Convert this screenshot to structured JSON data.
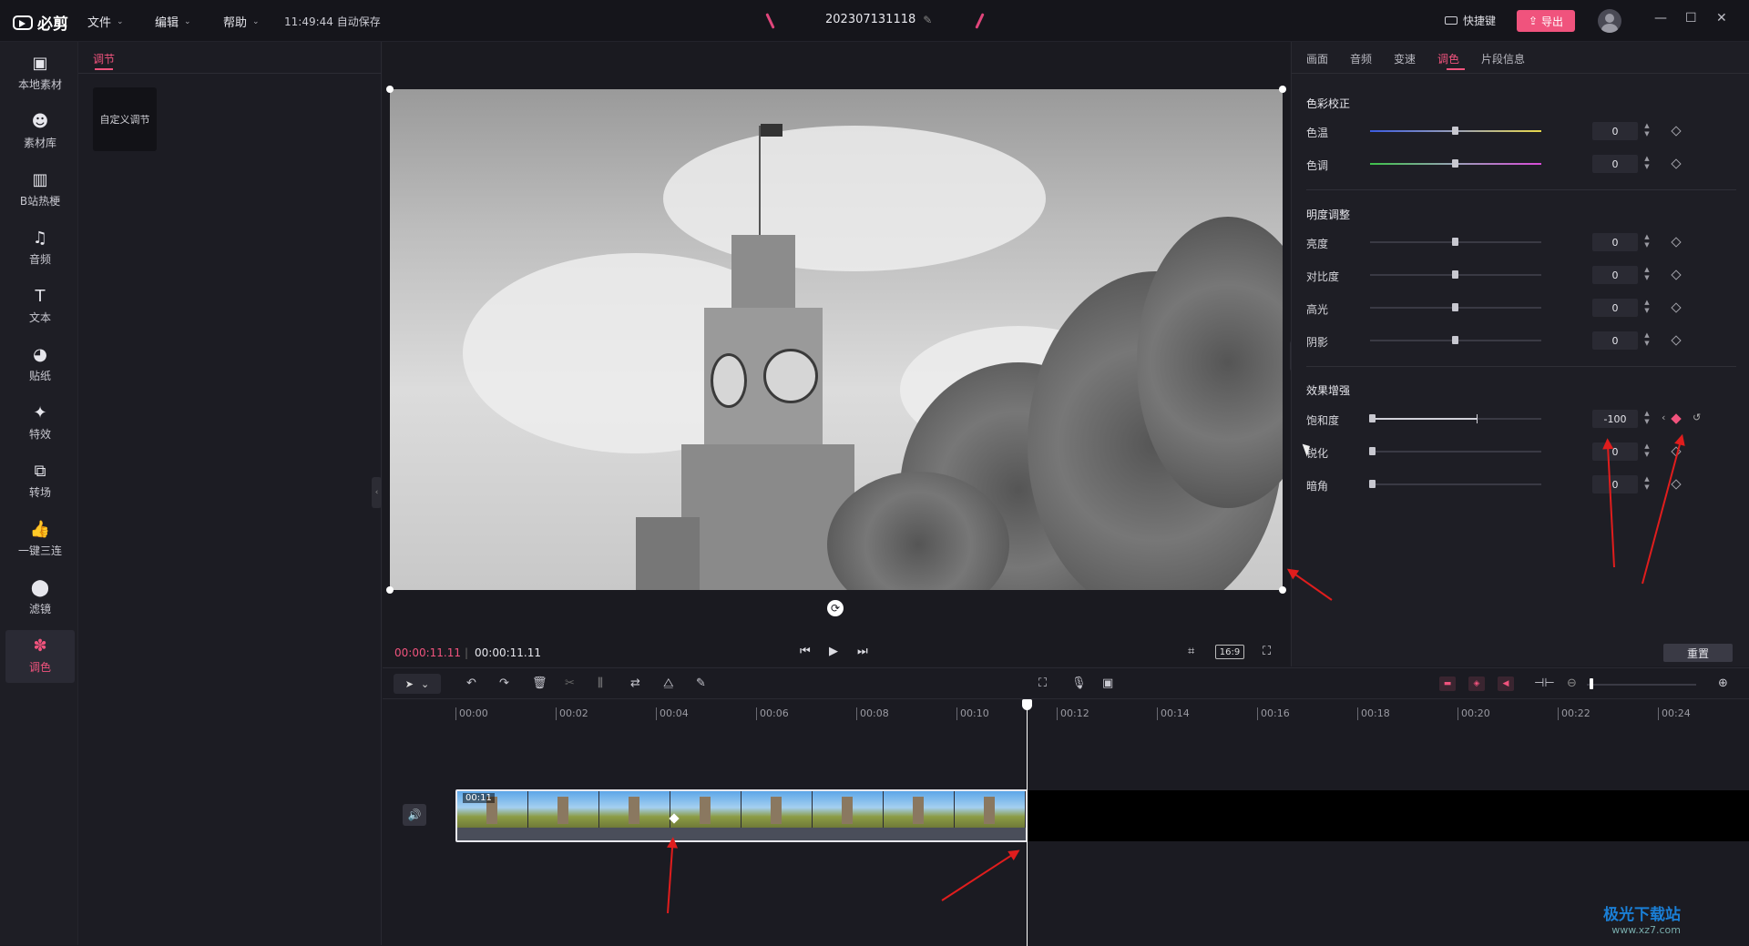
{
  "app": {
    "logo": "必剪",
    "menus": [
      "文件",
      "编辑",
      "帮助"
    ],
    "autosave": "11:49:44 自动保存",
    "project_name": "202307131118",
    "shortcut_label": "快捷键",
    "export_label": "导出",
    "window_controls": [
      "—",
      "☐",
      "✕"
    ]
  },
  "sidebar": {
    "items": [
      {
        "label": "本地素材",
        "icon": "folder-icon"
      },
      {
        "label": "素材库",
        "icon": "face-icon"
      },
      {
        "label": "B站热梗",
        "icon": "tv-icon"
      },
      {
        "label": "音频",
        "icon": "music-icon"
      },
      {
        "label": "文本",
        "icon": "text-icon"
      },
      {
        "label": "贴纸",
        "icon": "sticker-icon"
      },
      {
        "label": "特效",
        "icon": "star-icon"
      },
      {
        "label": "转场",
        "icon": "transition-icon"
      },
      {
        "label": "一键三连",
        "icon": "thumbs-up-icon"
      },
      {
        "label": "滤镜",
        "icon": "filter-icon"
      },
      {
        "label": "调色",
        "icon": "palette-icon"
      }
    ],
    "active_index": 10
  },
  "adjust_panel": {
    "tab": "调节",
    "card": "自定义调节"
  },
  "preview": {
    "current_time": "00:00:11.11",
    "total_time": "00:00:11.11",
    "aspect": "16:9"
  },
  "inspector": {
    "tabs": [
      "画面",
      "音频",
      "变速",
      "调色",
      "片段信息"
    ],
    "active_tab": "调色",
    "sections": [
      {
        "title": "色彩校正",
        "params": [
          {
            "label": "色温",
            "value": "0",
            "level": 0.5
          },
          {
            "label": "色调",
            "value": "0",
            "level": 0.5
          }
        ]
      },
      {
        "title": "明度调整",
        "params": [
          {
            "label": "亮度",
            "value": "0",
            "level": 0.5
          },
          {
            "label": "对比度",
            "value": "0",
            "level": 0.5
          },
          {
            "label": "高光",
            "value": "0",
            "level": 0.5
          },
          {
            "label": "阴影",
            "value": "0",
            "level": 0.5
          }
        ]
      },
      {
        "title": "效果增强",
        "params": [
          {
            "label": "饱和度",
            "value": "-100",
            "level": 0.0
          },
          {
            "label": "锐化",
            "value": "0",
            "level": 0.0
          },
          {
            "label": "暗角",
            "value": "0",
            "level": 0.0
          }
        ]
      }
    ],
    "reset_label": "重置"
  },
  "timeline": {
    "ticks": [
      "00:00",
      "00:02",
      "00:04",
      "00:06",
      "00:08",
      "00:10",
      "00:12",
      "00:14",
      "00:16",
      "00:18",
      "00:20",
      "00:22",
      "00:24"
    ],
    "clip_time": "00:11"
  },
  "watermark": {
    "title": "极光下载站",
    "url": "www.xz7.com"
  },
  "colors": {
    "accent": "#f0537d",
    "arrow": "#e01d1d"
  }
}
